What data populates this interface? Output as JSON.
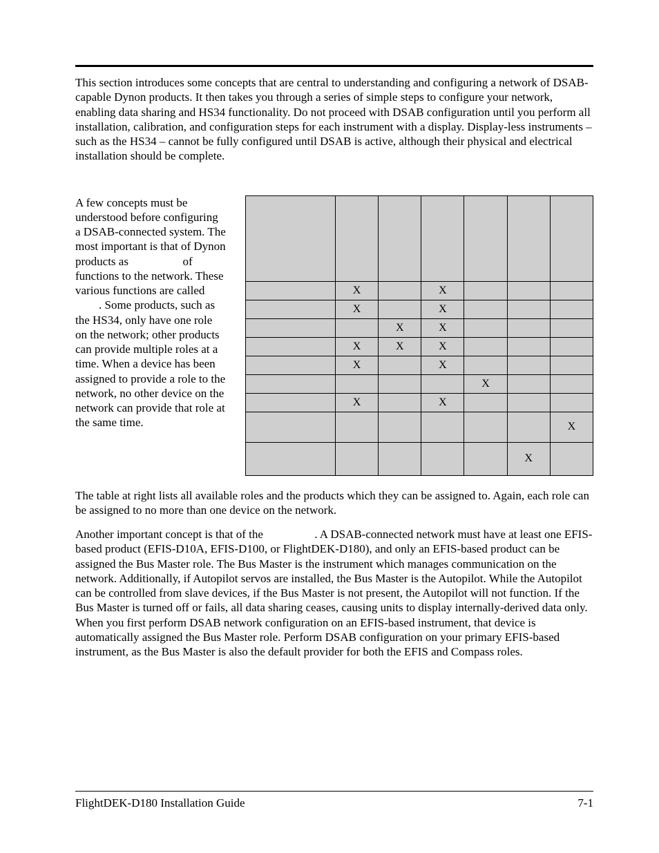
{
  "intro": "This section introduces some concepts that are central to understanding and configuring a network of DSAB-capable Dynon products. It then takes you through a series of simple steps to configure your network, enabling data sharing and HS34 functionality. Do not proceed with DSAB configuration until you perform all installation, calibration, and configuration steps for each instrument with a display. Display-less instruments – such as the HS34 – cannot be fully configured until DSAB is active, although their physical and electrical installation should be complete.",
  "concepts": {
    "p1a": "A few concepts must be understood before configuring a DSAB-connected system. The most important is that of Dynon products as ",
    "p1b": " of functions to the network. These various functions are called ",
    "p1c": ". Some products, such as the HS34, only have one role on the network; other products can provide multiple roles at a time. When a device has been assigned to provide a role to the network, no other device on the network can provide that role at the same time."
  },
  "table": {
    "headers": [
      "",
      "",
      "",
      "",
      "",
      "",
      ""
    ],
    "rows": [
      {
        "label": "",
        "cells": [
          "X",
          "",
          "X",
          "",
          "",
          ""
        ],
        "cls": ""
      },
      {
        "label": "",
        "cells": [
          "X",
          "",
          "X",
          "",
          "",
          ""
        ],
        "cls": ""
      },
      {
        "label": "",
        "cells": [
          "",
          "X",
          "X",
          "",
          "",
          ""
        ],
        "cls": ""
      },
      {
        "label": "",
        "cells": [
          "X",
          "X",
          "X",
          "",
          "",
          ""
        ],
        "cls": ""
      },
      {
        "label": "",
        "cells": [
          "X",
          "",
          "X",
          "",
          "",
          ""
        ],
        "cls": ""
      },
      {
        "label": "",
        "cells": [
          "",
          "",
          "",
          "X",
          "",
          ""
        ],
        "cls": ""
      },
      {
        "label": "",
        "cells": [
          "X",
          "",
          "X",
          "",
          "",
          ""
        ],
        "cls": ""
      },
      {
        "label": "",
        "cells": [
          "",
          "",
          "",
          "",
          "",
          "X"
        ],
        "cls": "tall"
      },
      {
        "label": "",
        "cells": [
          "",
          "",
          "",
          "",
          "X",
          ""
        ],
        "cls": "med"
      }
    ]
  },
  "after1": "The table at right lists all available roles and the products which they can be assigned to. Again, each role can be assigned to no more than one device on the network.",
  "after2a": "Another important concept is that of the ",
  "after2b": ". A DSAB-connected network must have at least one EFIS-based product (EFIS-D10A, EFIS-D100, or FlightDEK-D180), and only an EFIS-based product can be assigned the Bus Master role. The Bus Master is the instrument which manages communication on the network. Additionally, if Autopilot servos are installed, the Bus Master is the Autopilot. While the Autopilot can be controlled from slave devices, if the Bus Master is not present, the Autopilot will not function. If the Bus Master is turned off or fails, all data sharing ceases, causing units to display internally-derived data only. When you first perform DSAB network configuration on an EFIS-based instrument, that device is automatically assigned the Bus Master role. Perform DSAB configuration on your primary EFIS-based instrument, as the Bus Master is also the default provider for both the EFIS and Compass roles.",
  "footer": {
    "left": "FlightDEK-D180 Installation Guide",
    "right": "7-1"
  }
}
